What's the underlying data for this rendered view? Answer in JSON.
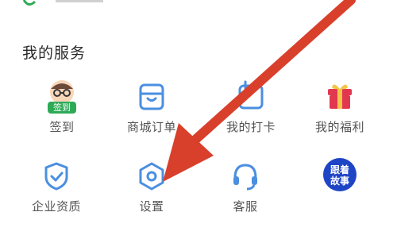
{
  "section": {
    "title": "我的服务"
  },
  "services": [
    {
      "label": "签到",
      "icon": "checkin-avatar-icon",
      "badge": "签到"
    },
    {
      "label": "商城订单",
      "icon": "store-icon"
    },
    {
      "label": "我的打卡",
      "icon": "calendar-icon"
    },
    {
      "label": "我的福利",
      "icon": "gift-icon"
    },
    {
      "label": "企业资质",
      "icon": "shield-check-icon"
    },
    {
      "label": "设置",
      "icon": "settings-hexagon-icon"
    },
    {
      "label": "客服",
      "icon": "headset-icon"
    },
    {
      "label": "跟着故事",
      "icon": "story-badge-icon",
      "badge_lines": [
        "跟着",
        "故事"
      ]
    }
  ],
  "colors": {
    "accent_blue": "#4a8fe0",
    "checkin_green": "#2eaa57",
    "gift_red": "#e2384f",
    "story_blue": "#1e45c6",
    "arrow_red": "#d9402c"
  }
}
